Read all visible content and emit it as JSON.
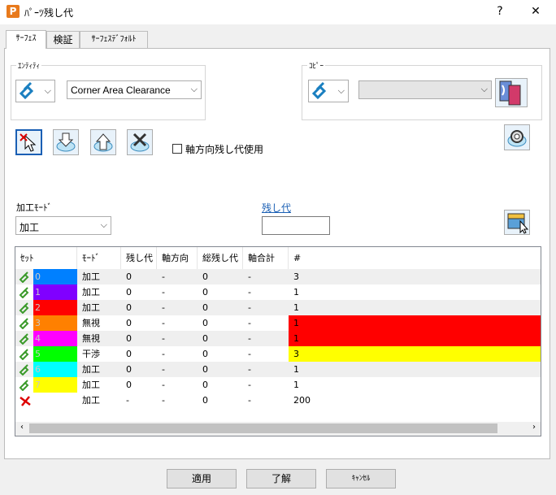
{
  "window": {
    "title": "ﾊﾟｰﾂ残し代",
    "help_label": "?",
    "close_label": "✕",
    "app_icon_letter": "P"
  },
  "tabs": [
    {
      "label": "ｻｰﾌｪｽ"
    },
    {
      "label": "検証"
    },
    {
      "label": "ｻｰﾌｪｽﾃﾞﾌｫﾙﾄ"
    }
  ],
  "entity": {
    "group_label": "ｴﾝﾃｨﾃｨ",
    "selected_value": "Corner Area Clearance"
  },
  "copy": {
    "group_label": "ｺﾋﾟｰ",
    "selected_value": ""
  },
  "axial_checkbox": {
    "label": "軸方向残し代使用",
    "checked": false
  },
  "machining_mode": {
    "label": "加工ﾓｰﾄﾞ",
    "selected_value": "加工"
  },
  "thickness": {
    "label": "残し代",
    "value": ""
  },
  "table": {
    "columns": [
      "ｾｯﾄ",
      "ﾓｰﾄﾞ",
      "残し代",
      "軸方向",
      "総残し代",
      "軸合計",
      "#"
    ],
    "rows": [
      {
        "set": "0",
        "color": "#0080ff",
        "mode": "加工",
        "thickness": "0",
        "axial": "-",
        "total": "0",
        "axial_total": "-",
        "count": "3",
        "count_bg": ""
      },
      {
        "set": "1",
        "color": "#8000ff",
        "mode": "加工",
        "thickness": "0",
        "axial": "-",
        "total": "0",
        "axial_total": "-",
        "count": "1",
        "count_bg": ""
      },
      {
        "set": "2",
        "color": "#ff0000",
        "mode": "加工",
        "thickness": "0",
        "axial": "-",
        "total": "0",
        "axial_total": "-",
        "count": "1",
        "count_bg": ""
      },
      {
        "set": "3",
        "color": "#ff8000",
        "mode": "無視",
        "thickness": "0",
        "axial": "-",
        "total": "0",
        "axial_total": "-",
        "count": "1",
        "count_bg": "#ff0000"
      },
      {
        "set": "4",
        "color": "#ff00ff",
        "mode": "無視",
        "thickness": "0",
        "axial": "-",
        "total": "0",
        "axial_total": "-",
        "count": "1",
        "count_bg": "#ff0000"
      },
      {
        "set": "5",
        "color": "#00ff00",
        "mode": "干渉",
        "thickness": "0",
        "axial": "-",
        "total": "0",
        "axial_total": "-",
        "count": "3",
        "count_bg": "#ffff00"
      },
      {
        "set": "6",
        "color": "#00ffff",
        "mode": "加工",
        "thickness": "0",
        "axial": "-",
        "total": "0",
        "axial_total": "-",
        "count": "1",
        "count_bg": ""
      },
      {
        "set": "7",
        "color": "#ffff00",
        "mode": "加工",
        "thickness": "0",
        "axial": "-",
        "total": "0",
        "axial_total": "-",
        "count": "1",
        "count_bg": ""
      },
      {
        "set": "",
        "color": "",
        "mode": "加工",
        "thickness": "-",
        "axial": "-",
        "total": "0",
        "axial_total": "-",
        "count": "200",
        "count_bg": "",
        "unassigned": true
      }
    ]
  },
  "buttons": {
    "apply": "適用",
    "ok": "了解",
    "cancel": "ｷｬﾝｾﾙ"
  },
  "colors": {
    "accent": "#1a5fb4",
    "row_alt": "#efefef",
    "button_face": "#e1e1e1"
  }
}
